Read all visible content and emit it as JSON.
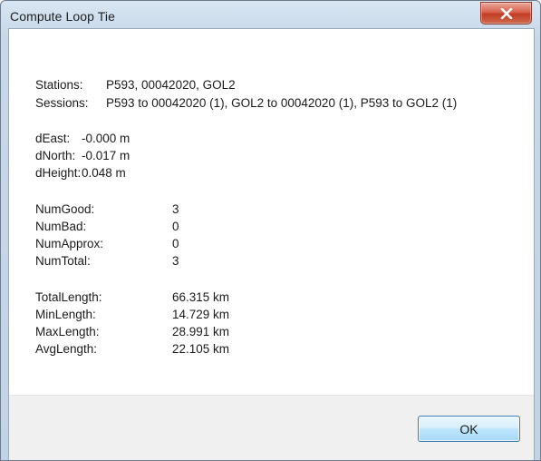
{
  "window": {
    "title": "Compute Loop Tie",
    "close_icon": "close-icon"
  },
  "summary": {
    "stations_label": "Stations:",
    "stations_value": "P593, 00042020, GOL2",
    "sessions_label": "Sessions:",
    "sessions_value": "P593 to 00042020 (1), GOL2 to 00042020 (1), P593 to GOL2 (1)"
  },
  "deltas": [
    {
      "label": "dEast:",
      "value": "-0.000 m"
    },
    {
      "label": "dNorth:",
      "value": "-0.017 m"
    },
    {
      "label": "dHeight:",
      "value": "0.048 m"
    }
  ],
  "counts": [
    {
      "label": "NumGood:",
      "value": "3"
    },
    {
      "label": "NumBad:",
      "value": "0"
    },
    {
      "label": "NumApprox:",
      "value": "0"
    },
    {
      "label": "NumTotal:",
      "value": "3"
    }
  ],
  "lengths": [
    {
      "label": "TotalLength:",
      "value": "66.315 km"
    },
    {
      "label": "MinLength:",
      "value": "14.729 km"
    },
    {
      "label": "MaxLength:",
      "value": "28.991 km"
    },
    {
      "label": "AvgLength:",
      "value": "22.105 km"
    }
  ],
  "footer": {
    "ok_label": "OK"
  }
}
